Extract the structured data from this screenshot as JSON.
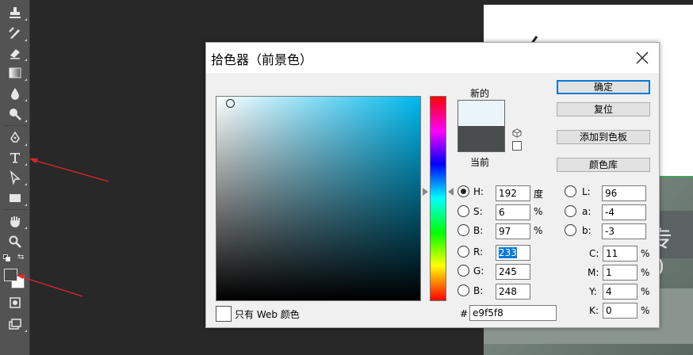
{
  "dialog": {
    "title": "拾色器（前景色）",
    "new_label": "新的",
    "current_label": "当前",
    "new_color": "#e9f5f8",
    "current_color": "#4a4d4d",
    "buttons": {
      "ok": "确定",
      "reset": "复位",
      "add_swatch": "添加到色板",
      "libraries": "颜色库"
    },
    "hsb": {
      "h": {
        "label": "H:",
        "value": "192",
        "unit": "度",
        "selected": true
      },
      "s": {
        "label": "S:",
        "value": "6",
        "unit": "%"
      },
      "b": {
        "label": "B:",
        "value": "97",
        "unit": "%"
      }
    },
    "rgb": {
      "r": {
        "label": "R:",
        "value": "233"
      },
      "g": {
        "label": "G:",
        "value": "245"
      },
      "b": {
        "label": "B:",
        "value": "248"
      }
    },
    "lab": {
      "l": {
        "label": "L:",
        "value": "96"
      },
      "a": {
        "label": "a:",
        "value": "-4"
      },
      "b": {
        "label": "b:",
        "value": "-3"
      }
    },
    "cmyk": {
      "c": {
        "label": "C:",
        "value": "11",
        "unit": "%"
      },
      "m": {
        "label": "M:",
        "value": "1",
        "unit": "%"
      },
      "y": {
        "label": "Y:",
        "value": "4",
        "unit": "%"
      },
      "k": {
        "label": "K:",
        "value": "0",
        "unit": "%"
      }
    },
    "hex_label": "#",
    "hex_value": "e9f5f8",
    "web_only_label": "只有 Web 颜色"
  },
  "toolbar": {
    "tools": [
      "clone-stamp-icon",
      "history-brush-icon",
      "eraser-icon",
      "gradient-icon",
      "blur-drop-icon",
      "dodge-icon",
      "pen-icon",
      "type-icon",
      "path-selection-icon",
      "rectangle-icon",
      "hand-icon",
      "zoom-icon"
    ],
    "foreground": "#4a4a4a",
    "background": "#ffffff"
  },
  "canvas": {
    "glyph_right": "专 0"
  },
  "colors": {
    "annotation_arrow": "#e0262a",
    "accent": "#0078d7"
  }
}
